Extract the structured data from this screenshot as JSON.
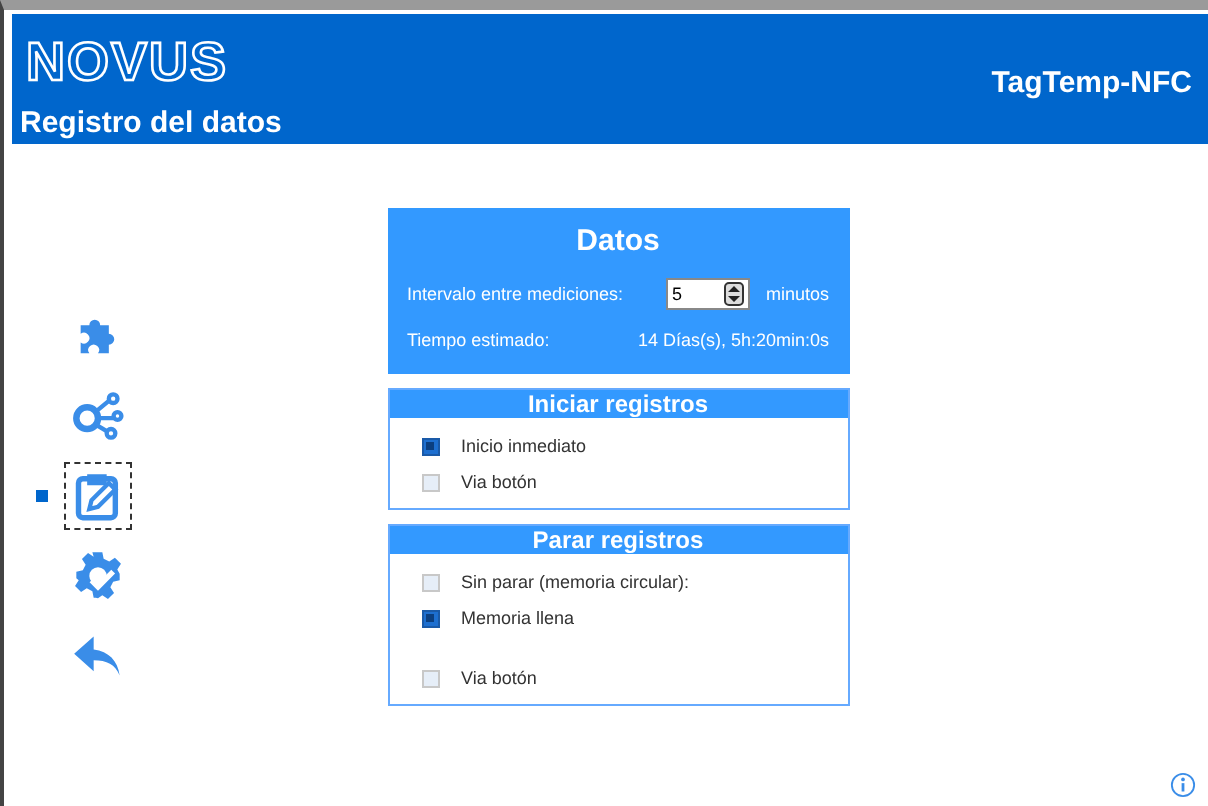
{
  "header": {
    "logo": "NOVUS",
    "page_title": "Registro del datos",
    "device": "TagTemp-NFC"
  },
  "nav": [
    {
      "selected": false
    },
    {
      "selected": false
    },
    {
      "selected": true
    },
    {
      "selected": false
    },
    {
      "selected": false
    }
  ],
  "datos": {
    "title": "Datos",
    "interval_label": "Intervalo entre mediciones:",
    "interval_value": "5",
    "interval_unit": "minutos",
    "estimate_label": "Tiempo estimado:",
    "estimate_value": "14 Días(s), 5h:20min:0s"
  },
  "groups": [
    {
      "title": "Iniciar registros",
      "options": [
        {
          "label": "Inicio inmediato",
          "selected": true
        },
        {
          "label": "Via botón",
          "selected": false
        }
      ]
    },
    {
      "title": "Parar registros",
      "options": [
        {
          "label": "Sin parar (memoria circular):",
          "selected": false
        },
        {
          "label": "Memoria llena",
          "selected": true
        },
        {
          "label": "Via botón",
          "selected": false
        }
      ]
    }
  ]
}
